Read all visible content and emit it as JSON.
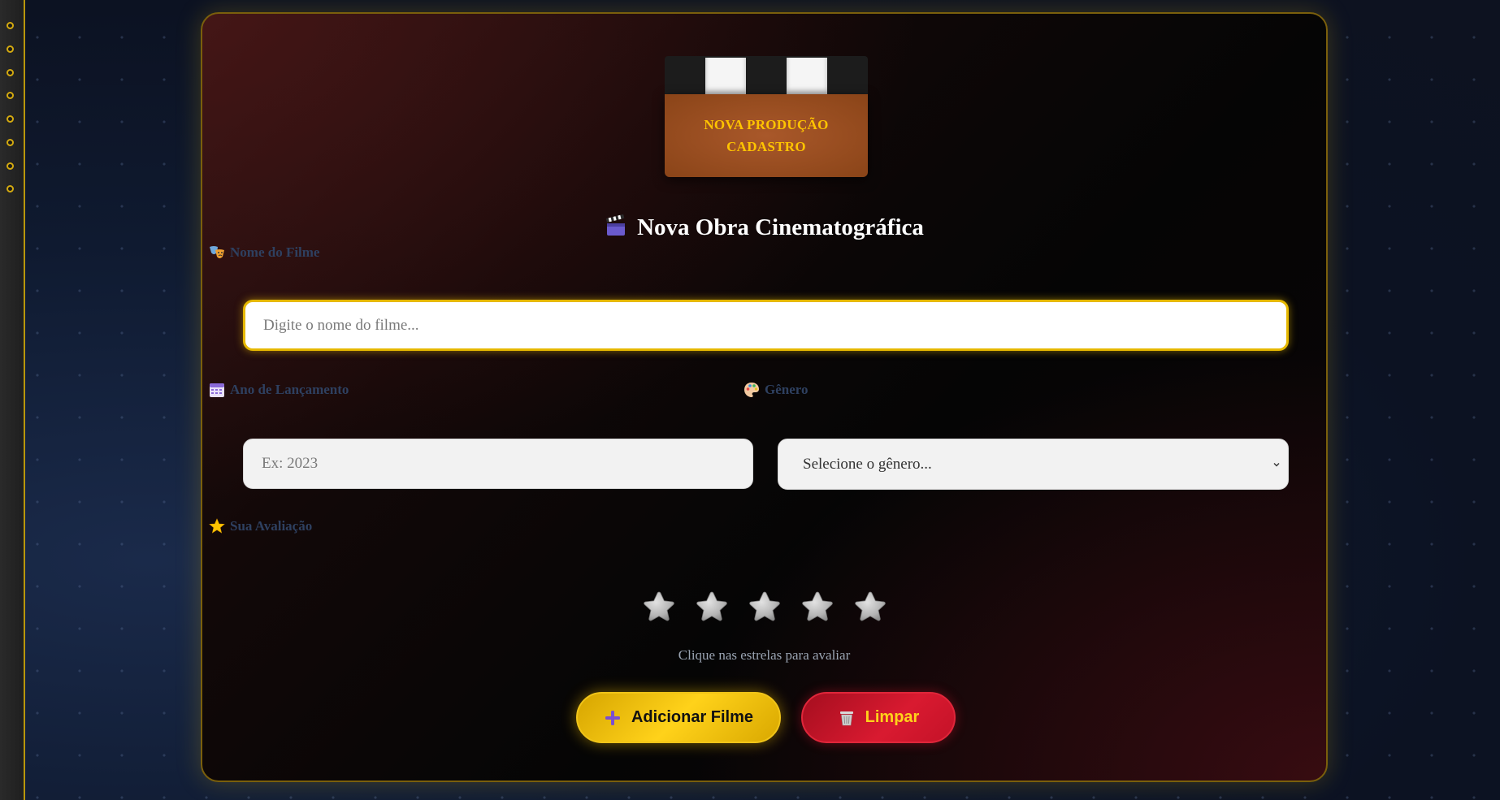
{
  "clapperboard": {
    "line1": "NOVA PRODUÇÃO",
    "line2": "CADASTRO"
  },
  "form": {
    "title": "Nova Obra Cinematográfica",
    "title_icon": "clapperboard-icon",
    "name_field": {
      "label": "Nome do Filme",
      "icon": "theater-masks-icon",
      "placeholder": "Digite o nome do filme...",
      "value": ""
    },
    "year_field": {
      "label": "Ano de Lançamento",
      "icon": "calendar-icon",
      "placeholder": "Ex: 2023",
      "value": ""
    },
    "genre_field": {
      "label": "Gênero",
      "icon": "palette-icon",
      "selected": "Selecione o gênero..."
    },
    "rating": {
      "label": "Sua Avaliação",
      "icon": "star-icon",
      "max_stars": 5,
      "selected_stars": 0,
      "hint": "Clique nas estrelas para avaliar"
    },
    "buttons": {
      "add_label": "Adicionar Filme",
      "add_icon": "plus-icon",
      "clear_label": "Limpar",
      "clear_icon": "trash-icon"
    }
  },
  "colors": {
    "accent_gold": "#ffc400",
    "danger_red": "#d91a30",
    "label_blue": "#2e4060"
  }
}
